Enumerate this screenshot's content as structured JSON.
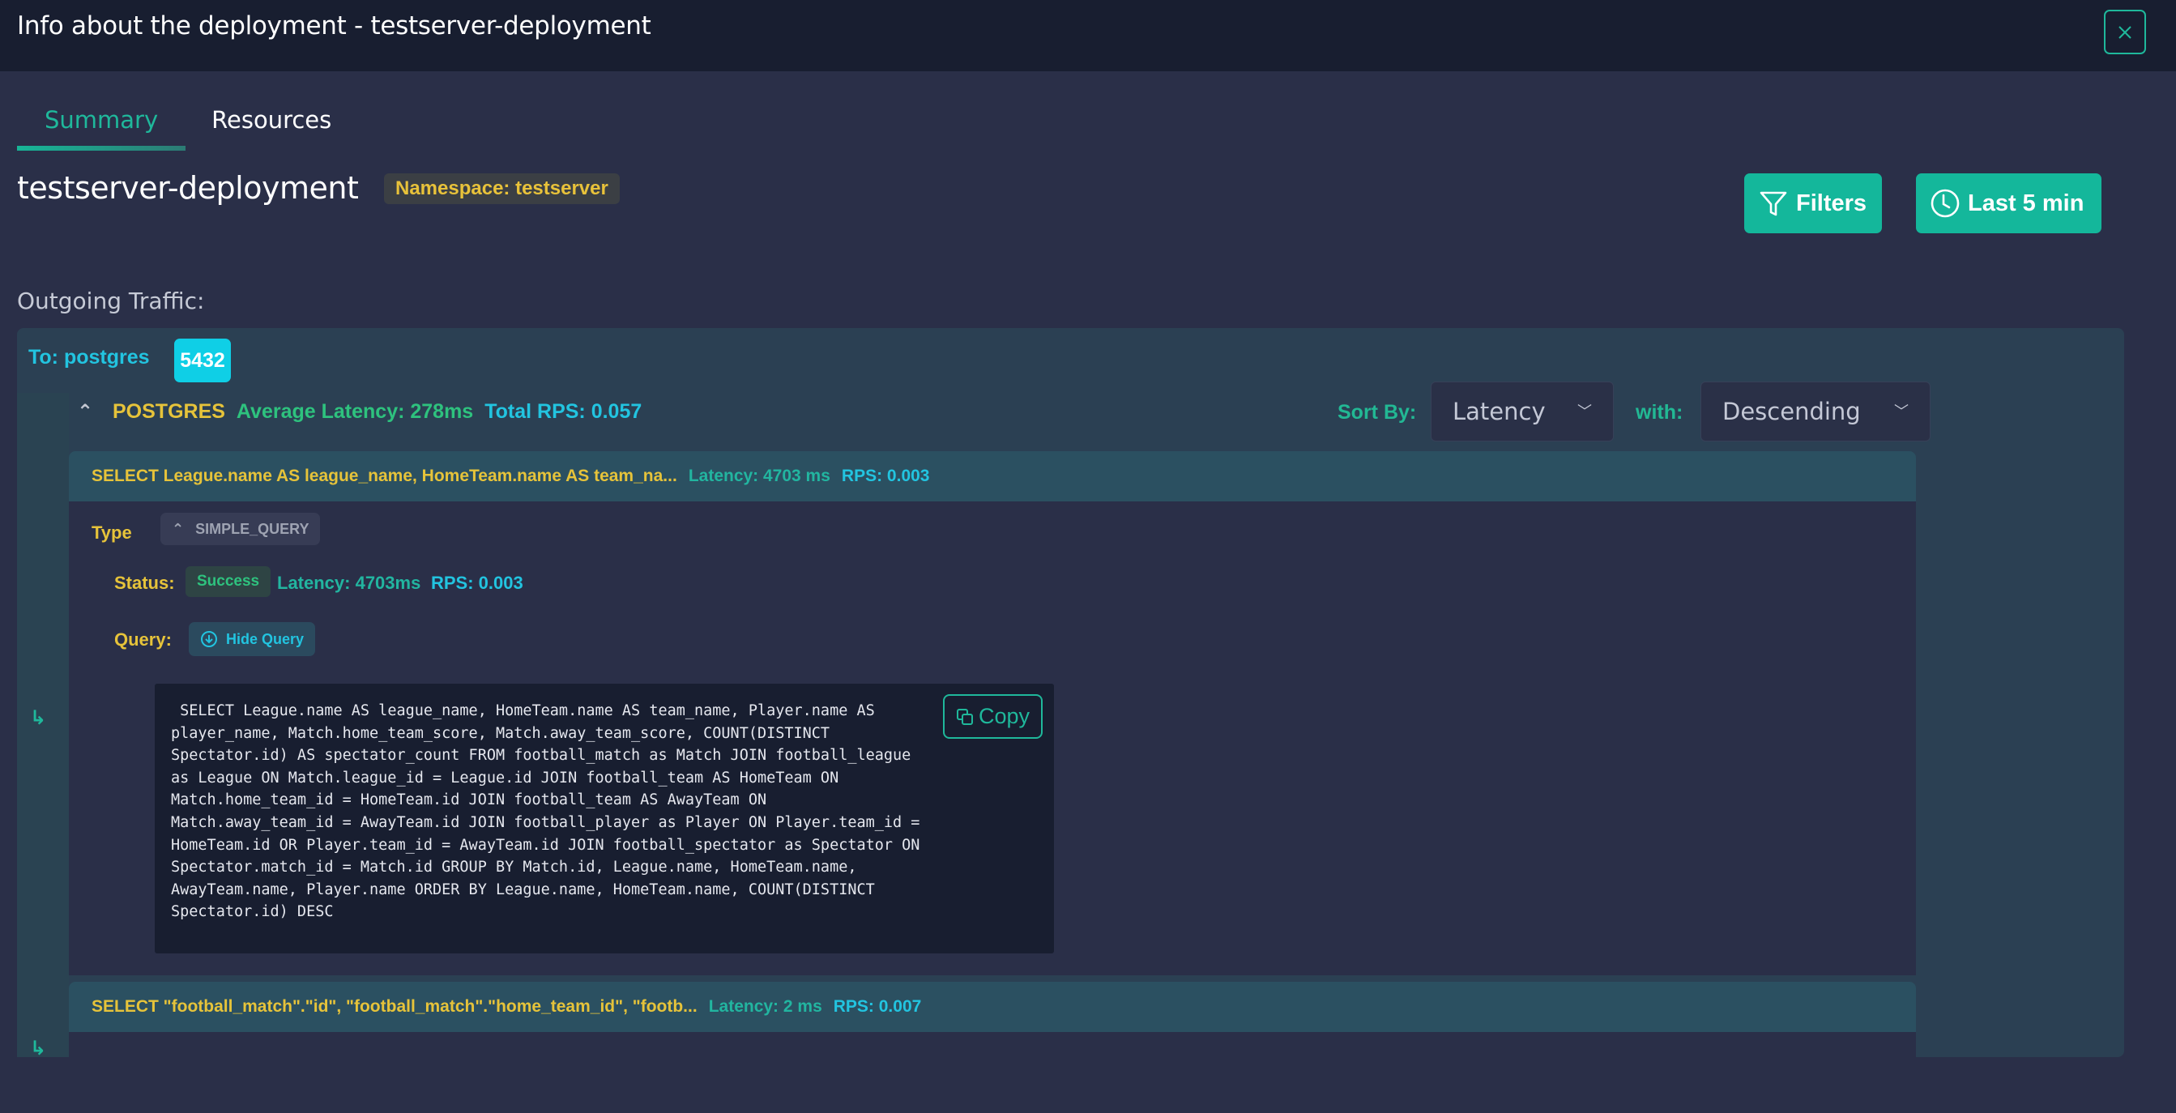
{
  "modal": {
    "title": "Info about the deployment - testserver-deployment",
    "close_icon": "close-icon"
  },
  "tabs": [
    {
      "label": "Summary",
      "active": true
    },
    {
      "label": "Resources",
      "active": false
    }
  ],
  "deployment": {
    "name": "testserver-deployment",
    "namespace_badge": "Namespace: testserver"
  },
  "toolbar": {
    "filters_label": "Filters",
    "filters_icon": "filter-icon",
    "time_label": "Last 5 min",
    "time_icon": "clock-icon"
  },
  "outgoing": {
    "label": "Outgoing Traffic:",
    "destination": "To: postgres",
    "port": "5432",
    "protocol": {
      "name": "POSTGRES",
      "average_latency": "Average Latency: 278ms",
      "total_rps": "Total RPS: 0.057",
      "expanded": true
    },
    "sort": {
      "sort_by_label": "Sort By:",
      "sort_by_value": "Latency",
      "with_label": "with:",
      "order_value": "Descending"
    },
    "queries": [
      {
        "sql_preview": "SELECT League.name AS league_name, HomeTeam.name AS team_na...",
        "latency": "Latency: 4703 ms",
        "rps": "RPS: 0.003",
        "expanded": true,
        "type_label": "Type",
        "type_value": "SIMPLE_QUERY",
        "status_label": "Status:",
        "status_value": "Success",
        "detail_latency": "Latency: 4703ms",
        "detail_rps": "RPS: 0.003",
        "query_label": "Query:",
        "hide_query_label": "Hide Query",
        "copy_label": "Copy",
        "full_sql": " SELECT League.name AS league_name, HomeTeam.name AS team_name, Player.name AS\nplayer_name, Match.home_team_score, Match.away_team_score, COUNT(DISTINCT\nSpectator.id) AS spectator_count FROM football_match as Match JOIN football_league\nas League ON Match.league_id = League.id JOIN football_team AS HomeTeam ON\nMatch.home_team_id = HomeTeam.id JOIN football_team AS AwayTeam ON\nMatch.away_team_id = AwayTeam.id JOIN football_player as Player ON Player.team_id =\nHomeTeam.id OR Player.team_id = AwayTeam.id JOIN football_spectator as Spectator ON\nSpectator.match_id = Match.id GROUP BY Match.id, League.name, HomeTeam.name,\nAwayTeam.name, Player.name ORDER BY League.name, HomeTeam.name, COUNT(DISTINCT\nSpectator.id) DESC"
      },
      {
        "sql_preview": "SELECT \"football_match\".\"id\", \"football_match\".\"home_team_id\", \"footb...",
        "latency": "Latency: 2 ms",
        "rps": "RPS: 0.007",
        "expanded": false
      }
    ]
  },
  "colors": {
    "accent": "#1fb89b",
    "header_bg": "#181e30",
    "page_bg": "#2a2f48",
    "panel_bg": "#2b4053",
    "yellow": "#e6c33a",
    "cyan": "#22c4e0",
    "green": "#2ec27e"
  }
}
